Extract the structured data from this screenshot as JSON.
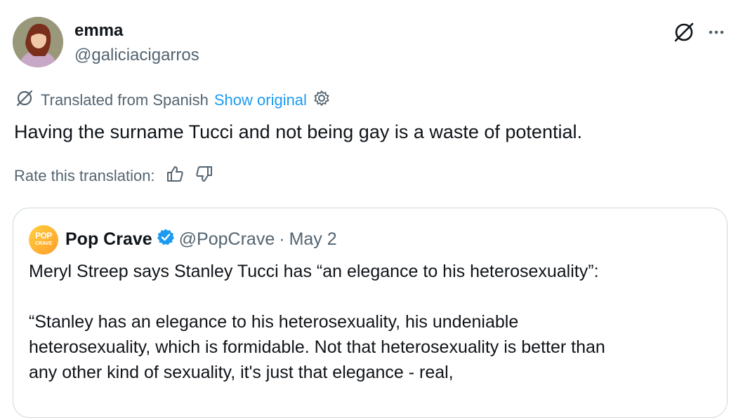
{
  "tweet": {
    "author_name": "emma",
    "author_handle": "@galiciacigarros",
    "translated_label": "Translated from Spanish",
    "show_original": "Show original",
    "text": "Having the surname Tucci and not being gay is a waste of potential.",
    "rate_label": "Rate this translation:",
    "icons": [
      "translate-icon",
      "more-icon",
      "gear-icon",
      "thumbs-up-icon",
      "thumbs-down-icon"
    ]
  },
  "quote": {
    "author_name": "Pop Crave",
    "author_handle": "@PopCrave",
    "separator": "·",
    "date": "May 2",
    "avatar_top": "POP",
    "avatar_bottom": "CRAVE",
    "line1": "Meryl Streep says Stanley Tucci has “an elegance to his heterosexuality”:",
    "line2": "“Stanley has an elegance to his heterosexuality, his undeniable",
    "line3": "heterosexuality, which is formidable. Not that heterosexuality is better than",
    "line4": "any other kind of sexuality, it's just that elegance - real,",
    "colors": {
      "verified": "#1d9bf0",
      "link": "#1d9bf0",
      "muted": "#536471"
    }
  }
}
